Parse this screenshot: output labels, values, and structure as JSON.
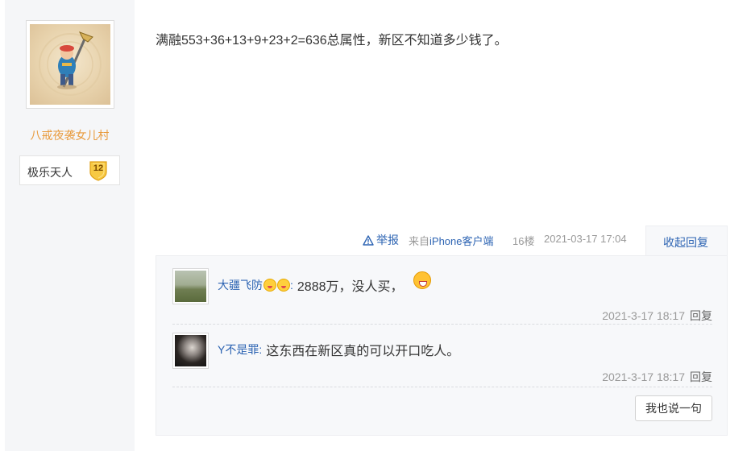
{
  "author": {
    "name": "八戒夜袭女儿村",
    "badge_title": "极乐天人",
    "badge_level": "12"
  },
  "post": {
    "content": "满融553+36+13+9+23+2=636总属性，新区不知道多少钱了。",
    "report_label": "举报",
    "client_prefix": "来自",
    "client_name": "iPhone客户端",
    "floor": "16楼",
    "time": "2021-03-17 17:04",
    "collapse_label": "收起回复"
  },
  "replies": [
    {
      "user": "大疆飞防",
      "separator": ":",
      "text": "2888万，没人买，",
      "time": "2021-3-17 18:17",
      "reply_label": "回复"
    },
    {
      "user": "Y不是罪",
      "separator": ":",
      "text": "这东西在新区真的可以开口吃人。",
      "time": "2021-3-17 18:17",
      "reply_label": "回复"
    }
  ],
  "say_button_label": "我也说一句",
  "colors": {
    "link": "#2d64b3",
    "author_name": "#e89a3c",
    "muted": "#999999",
    "panel_bg": "#f7f8fa"
  }
}
